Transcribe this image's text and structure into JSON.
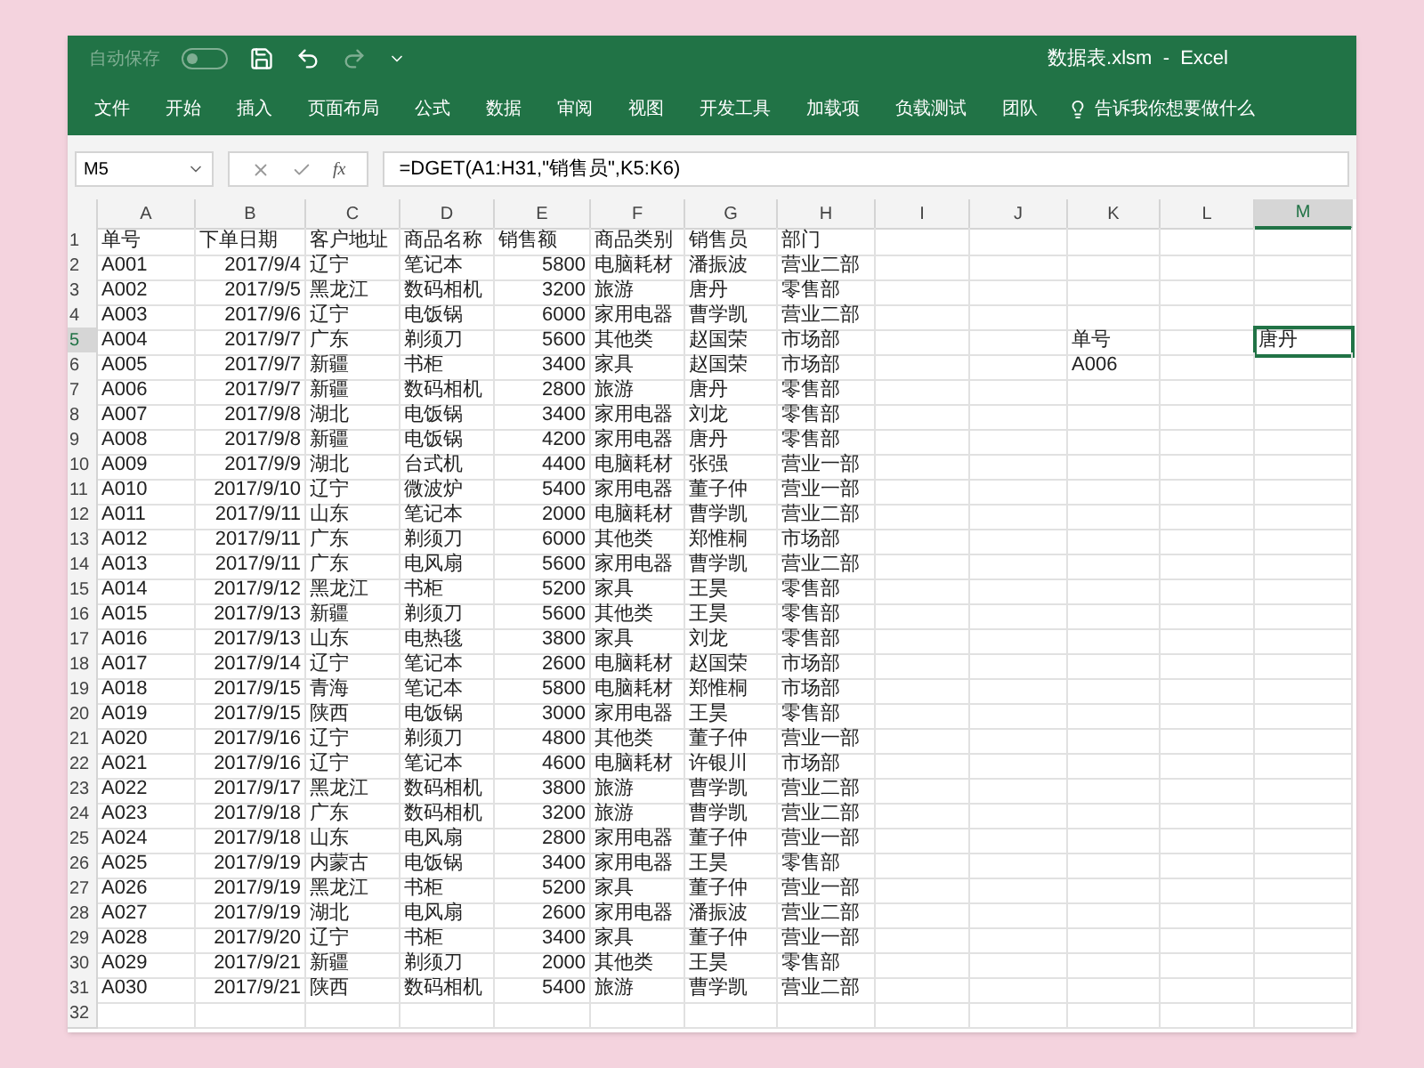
{
  "title_bar": {
    "autosave": {
      "label": "自动保存",
      "on": false
    },
    "title": "数据表.xlsm  -  Excel"
  },
  "ribbon_tabs": [
    {
      "label": "文件"
    },
    {
      "label": "开始"
    },
    {
      "label": "插入"
    },
    {
      "label": "页面布局"
    },
    {
      "label": "公式"
    },
    {
      "label": "数据"
    },
    {
      "label": "审阅"
    },
    {
      "label": "视图"
    },
    {
      "label": "开发工具"
    },
    {
      "label": "加载项"
    },
    {
      "label": "负载测试"
    },
    {
      "label": "团队"
    }
  ],
  "tell_me": {
    "placeholder": "告诉我你想要做什么"
  },
  "formula_bar": {
    "name_box": "M5",
    "function_button": "fx",
    "formula": "=DGET(A1:H31,\"销售员\",K5:K6)"
  },
  "columns": [
    {
      "label": "A",
      "selected": false
    },
    {
      "label": "B",
      "selected": false
    },
    {
      "label": "C",
      "selected": false
    },
    {
      "label": "D",
      "selected": false
    },
    {
      "label": "E",
      "selected": false
    },
    {
      "label": "F",
      "selected": false
    },
    {
      "label": "G",
      "selected": false
    },
    {
      "label": "H",
      "selected": false
    },
    {
      "label": "I",
      "selected": false
    },
    {
      "label": "J",
      "selected": false
    },
    {
      "label": "K",
      "selected": false
    },
    {
      "label": "L",
      "selected": false
    },
    {
      "label": "M",
      "selected": true
    }
  ],
  "rows": [
    {
      "number": "1",
      "selected": false,
      "cells": [
        "单号",
        "下单日期",
        "客户地址",
        "商品名称",
        "销售额",
        "商品类别",
        "销售员",
        "部门"
      ]
    },
    {
      "number": "2",
      "selected": false,
      "cells": [
        "A001",
        "2017/9/4",
        "辽宁",
        "笔记本",
        "5800",
        "电脑耗材",
        "潘振波",
        "营业二部"
      ]
    },
    {
      "number": "3",
      "selected": false,
      "cells": [
        "A002",
        "2017/9/5",
        "黑龙江",
        "数码相机",
        "3200",
        "旅游",
        "唐丹",
        "零售部"
      ]
    },
    {
      "number": "4",
      "selected": false,
      "cells": [
        "A003",
        "2017/9/6",
        "辽宁",
        "电饭锅",
        "6000",
        "家用电器",
        "曹学凯",
        "营业二部"
      ]
    },
    {
      "number": "5",
      "selected": true,
      "cells": [
        "A004",
        "2017/9/7",
        "广东",
        "剃须刀",
        "5600",
        "其他类",
        "赵国荣",
        "市场部"
      ],
      "column_k": "单号",
      "column_m": "唐丹"
    },
    {
      "number": "6",
      "selected": false,
      "cells": [
        "A005",
        "2017/9/7",
        "新疆",
        "书柜",
        "3400",
        "家具",
        "赵国荣",
        "市场部"
      ],
      "column_k": "A006"
    },
    {
      "number": "7",
      "selected": false,
      "cells": [
        "A006",
        "2017/9/7",
        "新疆",
        "数码相机",
        "2800",
        "旅游",
        "唐丹",
        "零售部"
      ]
    },
    {
      "number": "8",
      "selected": false,
      "cells": [
        "A007",
        "2017/9/8",
        "湖北",
        "电饭锅",
        "3400",
        "家用电器",
        "刘龙",
        "零售部"
      ]
    },
    {
      "number": "9",
      "selected": false,
      "cells": [
        "A008",
        "2017/9/8",
        "新疆",
        "电饭锅",
        "4200",
        "家用电器",
        "唐丹",
        "零售部"
      ]
    },
    {
      "number": "10",
      "selected": false,
      "cells": [
        "A009",
        "2017/9/9",
        "湖北",
        "台式机",
        "4400",
        "电脑耗材",
        "张强",
        "营业一部"
      ]
    },
    {
      "number": "11",
      "selected": false,
      "cells": [
        "A010",
        "2017/9/10",
        "辽宁",
        "微波炉",
        "5400",
        "家用电器",
        "董子仲",
        "营业一部"
      ]
    },
    {
      "number": "12",
      "selected": false,
      "cells": [
        "A011",
        "2017/9/11",
        "山东",
        "笔记本",
        "2000",
        "电脑耗材",
        "曹学凯",
        "营业二部"
      ]
    },
    {
      "number": "13",
      "selected": false,
      "cells": [
        "A012",
        "2017/9/11",
        "广东",
        "剃须刀",
        "6000",
        "其他类",
        "郑惟桐",
        "市场部"
      ]
    },
    {
      "number": "14",
      "selected": false,
      "cells": [
        "A013",
        "2017/9/11",
        "广东",
        "电风扇",
        "5600",
        "家用电器",
        "曹学凯",
        "营业二部"
      ]
    },
    {
      "number": "15",
      "selected": false,
      "cells": [
        "A014",
        "2017/9/12",
        "黑龙江",
        "书柜",
        "5200",
        "家具",
        "王昊",
        "零售部"
      ]
    },
    {
      "number": "16",
      "selected": false,
      "cells": [
        "A015",
        "2017/9/13",
        "新疆",
        "剃须刀",
        "5600",
        "其他类",
        "王昊",
        "零售部"
      ]
    },
    {
      "number": "17",
      "selected": false,
      "cells": [
        "A016",
        "2017/9/13",
        "山东",
        "电热毯",
        "3800",
        "家具",
        "刘龙",
        "零售部"
      ]
    },
    {
      "number": "18",
      "selected": false,
      "cells": [
        "A017",
        "2017/9/14",
        "辽宁",
        "笔记本",
        "2600",
        "电脑耗材",
        "赵国荣",
        "市场部"
      ]
    },
    {
      "number": "19",
      "selected": false,
      "cells": [
        "A018",
        "2017/9/15",
        "青海",
        "笔记本",
        "5800",
        "电脑耗材",
        "郑惟桐",
        "市场部"
      ]
    },
    {
      "number": "20",
      "selected": false,
      "cells": [
        "A019",
        "2017/9/15",
        "陕西",
        "电饭锅",
        "3000",
        "家用电器",
        "王昊",
        "零售部"
      ]
    },
    {
      "number": "21",
      "selected": false,
      "cells": [
        "A020",
        "2017/9/16",
        "辽宁",
        "剃须刀",
        "4800",
        "其他类",
        "董子仲",
        "营业一部"
      ]
    },
    {
      "number": "22",
      "selected": false,
      "cells": [
        "A021",
        "2017/9/16",
        "辽宁",
        "笔记本",
        "4600",
        "电脑耗材",
        "许银川",
        "市场部"
      ]
    },
    {
      "number": "23",
      "selected": false,
      "cells": [
        "A022",
        "2017/9/17",
        "黑龙江",
        "数码相机",
        "3800",
        "旅游",
        "曹学凯",
        "营业二部"
      ]
    },
    {
      "number": "24",
      "selected": false,
      "cells": [
        "A023",
        "2017/9/18",
        "广东",
        "数码相机",
        "3200",
        "旅游",
        "曹学凯",
        "营业二部"
      ]
    },
    {
      "number": "25",
      "selected": false,
      "cells": [
        "A024",
        "2017/9/18",
        "山东",
        "电风扇",
        "2800",
        "家用电器",
        "董子仲",
        "营业一部"
      ]
    },
    {
      "number": "26",
      "selected": false,
      "cells": [
        "A025",
        "2017/9/19",
        "内蒙古",
        "电饭锅",
        "3400",
        "家用电器",
        "王昊",
        "零售部"
      ]
    },
    {
      "number": "27",
      "selected": false,
      "cells": [
        "A026",
        "2017/9/19",
        "黑龙江",
        "书柜",
        "5200",
        "家具",
        "董子仲",
        "营业一部"
      ]
    },
    {
      "number": "28",
      "selected": false,
      "cells": [
        "A027",
        "2017/9/19",
        "湖北",
        "电风扇",
        "2600",
        "家用电器",
        "潘振波",
        "营业二部"
      ]
    },
    {
      "number": "29",
      "selected": false,
      "cells": [
        "A028",
        "2017/9/20",
        "辽宁",
        "书柜",
        "3400",
        "家具",
        "董子仲",
        "营业一部"
      ]
    },
    {
      "number": "30",
      "selected": false,
      "cells": [
        "A029",
        "2017/9/21",
        "新疆",
        "剃须刀",
        "2000",
        "其他类",
        "王昊",
        "零售部"
      ]
    },
    {
      "number": "31",
      "selected": false,
      "cells": [
        "A030",
        "2017/9/21",
        "陕西",
        "数码相机",
        "5400",
        "旅游",
        "曹学凯",
        "营业二部"
      ]
    },
    {
      "number": "32",
      "selected": false
    }
  ]
}
